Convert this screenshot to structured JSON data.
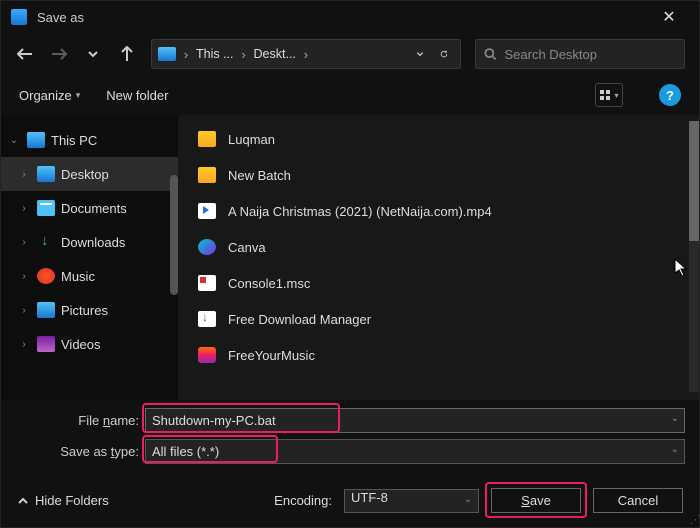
{
  "title": "Save as",
  "breadcrumbs": {
    "root": "This ...",
    "leaf": "Deskt..."
  },
  "search": {
    "placeholder": "Search Desktop"
  },
  "toolbar": {
    "organize": "Organize",
    "newfolder": "New folder"
  },
  "tree": {
    "thispc": "This PC",
    "items": [
      {
        "label": "Desktop"
      },
      {
        "label": "Documents"
      },
      {
        "label": "Downloads"
      },
      {
        "label": "Music"
      },
      {
        "label": "Pictures"
      },
      {
        "label": "Videos"
      }
    ]
  },
  "files": [
    {
      "label": "Luqman",
      "icon": "folder"
    },
    {
      "label": "New Batch",
      "icon": "folder"
    },
    {
      "label": "A Naija Christmas (2021) (NetNaija.com).mp4",
      "icon": "mp4"
    },
    {
      "label": "Canva",
      "icon": "canva"
    },
    {
      "label": "Console1.msc",
      "icon": "msc"
    },
    {
      "label": "Free Download Manager",
      "icon": "fdm"
    },
    {
      "label": "FreeYourMusic",
      "icon": "fym"
    }
  ],
  "fields": {
    "filename_label": "File name:",
    "filename_value": "Shutdown-my-PC.bat",
    "saveastype_label": "Save as type:",
    "saveastype_value": "All files  (*.*)"
  },
  "bottom": {
    "hidefolders": "Hide Folders",
    "encoding_label": "Encoding:",
    "encoding_value": "UTF-8",
    "save": "Save",
    "cancel": "Cancel"
  }
}
